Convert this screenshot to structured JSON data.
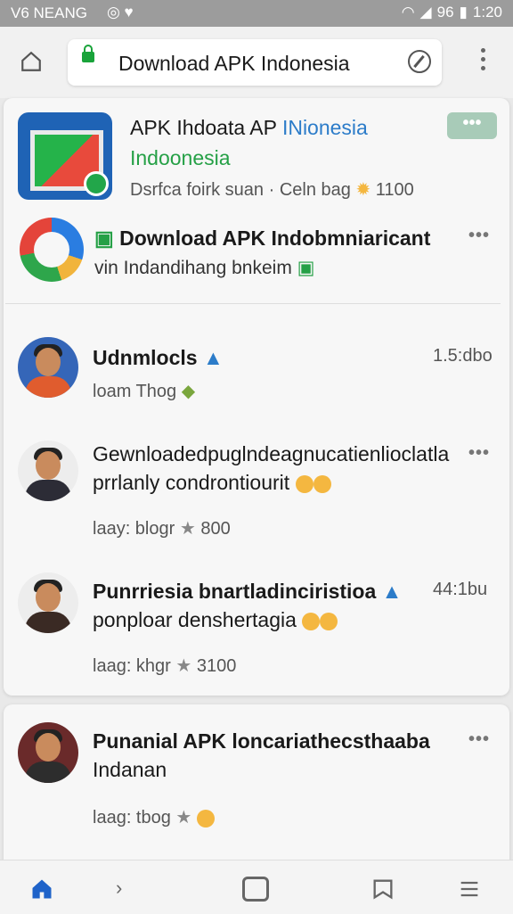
{
  "status": {
    "left_text": "V6 NEANG",
    "time": "1:20",
    "battery": "96"
  },
  "browser": {
    "url_text": "Download  APK Indonesia"
  },
  "app": {
    "title_dark": "APK Ihdoata AP",
    "title_blue": "INionesia",
    "title_green": "Indoonesia",
    "meta": "Dsrfca foirk suan · Celn bag",
    "meta_count": "1100"
  },
  "promo": {
    "line1": "Download APK Indobmniaricant",
    "line2": "vin  Indandihang bnkeim"
  },
  "posts": [
    {
      "name": "Udnmlocls",
      "text": "loam Thog",
      "time": "1.5:dbo"
    },
    {
      "line1": "Gewnloadedpuglndeagnucatienlioclatla",
      "line2": "prrlanly  condrontiourit",
      "meta": "laay: blogr",
      "count": "800"
    },
    {
      "name": "Punrriesia bnartladinciristioa",
      "time": "44:1bu",
      "line2": "ponploar denshertagia",
      "meta": "laag: khgr",
      "count": "3100"
    },
    {
      "name": "Punanial APK loncariathecsthaaba",
      "line2": "Indanan",
      "meta": "laag: tbog"
    }
  ]
}
